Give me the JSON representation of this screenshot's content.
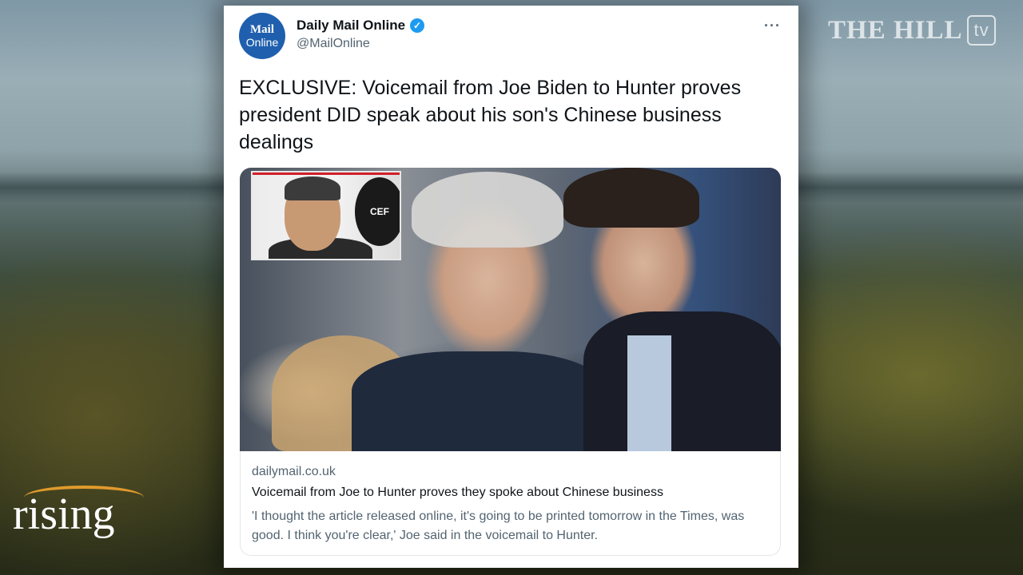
{
  "overlay": {
    "network_logo": "THE HILL",
    "network_logo_badge": "tv",
    "show_logo": "rising",
    "colors": {
      "rising_arc": "#e09a2c",
      "twitter_blue": "#1d9bf0",
      "dailymail_blue": "#1f5fae"
    }
  },
  "tweet": {
    "avatar_line1": "Mail",
    "avatar_line2": "Online",
    "display_name": "Daily Mail Online",
    "verified_icon": "verified-badge-icon",
    "handle": "@MailOnline",
    "more_icon": "···",
    "text": "EXCLUSIVE: Voicemail from Joe Biden to Hunter proves president DID speak about his son's Chinese business dealings",
    "media": {
      "inset_logo_text": "CEF"
    },
    "link_card": {
      "domain": "dailymail.co.uk",
      "title": "Voicemail from Joe to Hunter proves they spoke about Chinese business",
      "description": "'I thought the article released online, it's going to be printed tomorrow in the Times, was good. I think you're clear,' Joe said in the voicemail to Hunter."
    }
  }
}
